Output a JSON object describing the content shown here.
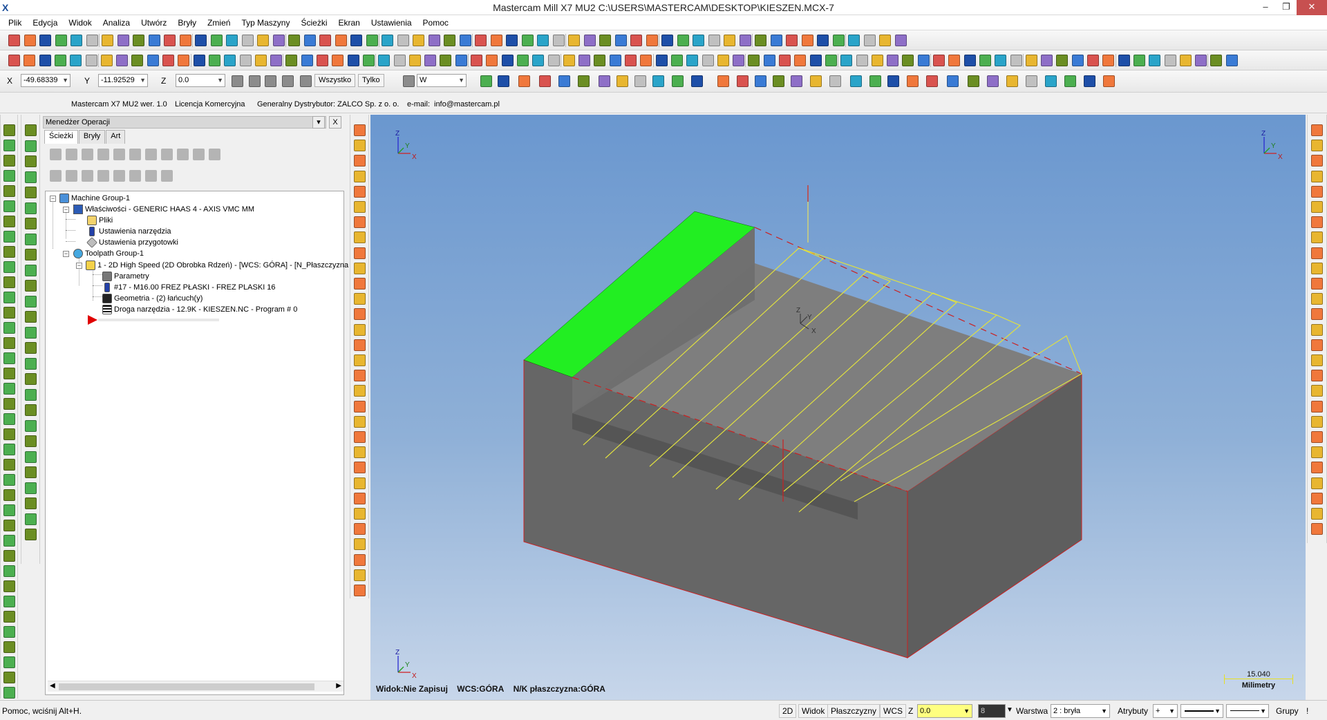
{
  "window": {
    "title": "Mastercam Mill X7 MU2  C:\\USERS\\MASTERCAM\\DESKTOP\\KIESZEN.MCX-7",
    "minimize": "–",
    "restore": "❐",
    "close": "✕",
    "app_icon": "X"
  },
  "menu": [
    "Plik",
    "Edycja",
    "Widok",
    "Analiza",
    "Utwórz",
    "Bryły",
    "Zmień",
    "Typ Maszyny",
    "Ścieżki",
    "Ekran",
    "Ustawienia",
    "Pomoc"
  ],
  "coords": {
    "x_label": "X",
    "x_value": "-49.68339",
    "y_label": "Y",
    "y_value": "-11.92529",
    "z_label": "Z",
    "z_value": "0.0",
    "all_button": "Wszystko",
    "only_button": "Tylko",
    "filter_value": "W"
  },
  "infobar": {
    "product": "Mastercam X7 MU2  wer. 1.0",
    "license": "Licencja Komercyjna",
    "distributor": "Generalny Dystrybutor:  ZALCO Sp. z o. o.",
    "email_label": "e-mail:",
    "email": "info@mastercam.pl"
  },
  "ops_manager": {
    "title": "Menedżer Operacji",
    "dropdown": "▾",
    "close": "X",
    "tabs": [
      "Ścieżki",
      "Bryły",
      "Art"
    ],
    "tree": {
      "machine_group": "Machine Group-1",
      "properties": "Właściwości - GENERIC HAAS 4 - AXIS VMC MM",
      "files": "Pliki",
      "tool_settings": "Ustawienia narzędzia",
      "stock_settings": "Ustawienia przygotowki",
      "toolpath_group": "Toolpath Group-1",
      "operation": "1 - 2D High Speed (2D Obrobka Rdzeń) - [WCS: GÓRA] - [N_Płaszczyzna",
      "parameters": "Parametry",
      "tool": "#17 - M16.00 FREZ PŁASKI - FREZ PLASKI 16",
      "geometry": "Geometria - (2) łańcuch(y)",
      "toolpath": "Droga narzędzia - 12.9K - KIESZEN.NC - Program # 0"
    }
  },
  "viewport": {
    "status_view": "Widok:Nie Zapisuj",
    "status_wcs": "WCS:GÓRA",
    "status_plane": "N/K płaszczyzna:GÓRA",
    "scale_value": "15.040",
    "scale_unit": "Milimetry",
    "axis_x": "X",
    "axis_y": "Y",
    "axis_z": "Z",
    "colors": {
      "top_face_highlight": "#22ee22",
      "solid": "#6e6e6e",
      "toolpath": "#e0e040",
      "edge_red": "#cc2020"
    }
  },
  "statusbar": {
    "help": "Pomoc, wciśnij Alt+H.",
    "btn_2d": "2D",
    "btn_view": "Widok",
    "btn_planes": "Płaszczyzny",
    "btn_wcs": "WCS",
    "z_label": "Z",
    "z_value": "0.0",
    "color_value": "8",
    "level_label": "Warstwa",
    "level_value": "2 : bryła",
    "attributes_label": "Atrybuty",
    "attr_value": "+",
    "groups_label": "Grupy",
    "extra": "!"
  }
}
